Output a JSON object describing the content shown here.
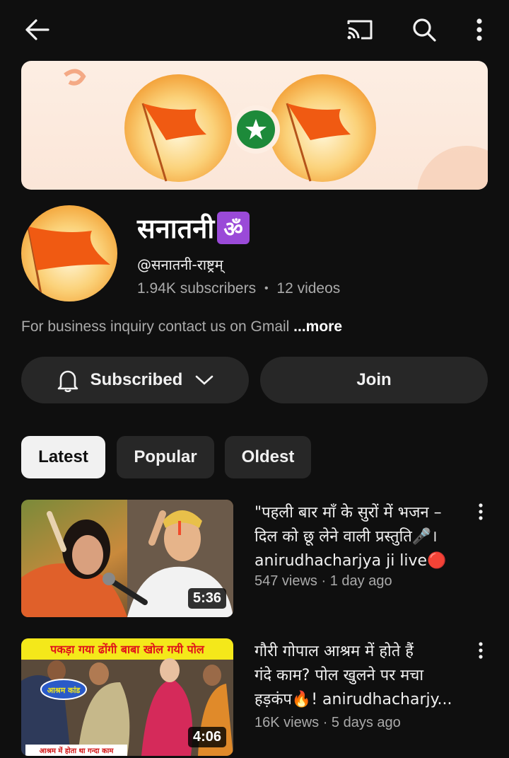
{
  "channel": {
    "name": "सनातनी",
    "handle": "@सनातनी-राष्ट्रम्",
    "subscribers": "1.94K subscribers",
    "separator": "•",
    "videos_count": "12 videos",
    "description": "For business inquiry contact us on Gmail ",
    "more_label": "...more"
  },
  "actions": {
    "subscribed_label": "Subscribed",
    "join_label": "Join"
  },
  "tabs": [
    {
      "label": "Latest",
      "active": true
    },
    {
      "label": "Popular",
      "active": false
    },
    {
      "label": "Oldest",
      "active": false
    }
  ],
  "videos": [
    {
      "title_line1": "\"पहली बार माँ के सुरों में भजन –",
      "title_line2": "दिल को छू लेने वाली प्रस्तुति🎤।",
      "title_line3": "anirudhacharjya ji live🔴",
      "meta": "547 views · 1 day ago",
      "duration": "5:36"
    },
    {
      "title_line1": "गौरी गोपाल आश्रम में होते हैं",
      "title_line2": "गंदे काम? पोल खुलने पर मचा",
      "title_line3": "हड़कंप🔥! anirudhacharjy...",
      "meta": "16K views · 5 days ago",
      "duration": "4:06",
      "thumb_text": "पकड़ा गया ढोंगी बाबा खोल गयी पोल",
      "thumb_badge": "आश्रम कांड",
      "thumb_bottom": "आश्रम में होता था गन्दा काम"
    }
  ],
  "icons": {
    "back": "back-arrow-icon",
    "cast": "cast-icon",
    "search": "search-icon",
    "more": "more-vert-icon",
    "bell": "bell-icon",
    "chevron": "chevron-down-icon",
    "om": "om-symbol"
  },
  "colors": {
    "background": "#0f0f0f",
    "chip_bg": "#272727",
    "saffron": "#f36b1c",
    "secondary_text": "#aaaaaa"
  }
}
